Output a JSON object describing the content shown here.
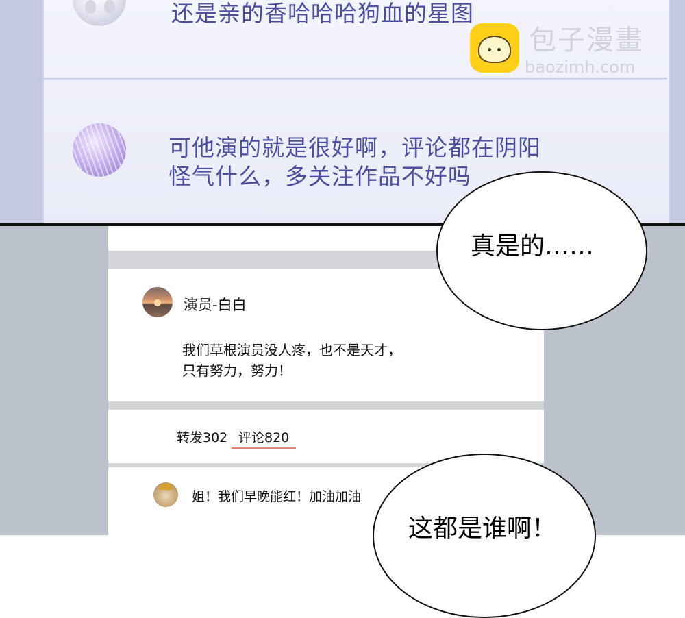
{
  "top_panel": {
    "comment1_text": "还是亲的香哈哈哈狗血的星图",
    "comment2_line1": "可他演的就是很好啊，评论都在阴阳",
    "comment2_line2": "怪气什么，多关注作品不好吗"
  },
  "watermark": {
    "name": "包子漫畫",
    "domain": "baozimh.com"
  },
  "post": {
    "author": "演员-白白",
    "body_line1": "我们草根演员没人疼，也不是天才，",
    "body_line2": "只有努力，努力！"
  },
  "stats": {
    "repost_label": "转发302",
    "comment_label": "评论820"
  },
  "reply": {
    "text": "姐！我们早晚能红！加油加油"
  },
  "bubbles": {
    "bubble1": "真是的……",
    "bubble2": "这都是谁啊！"
  },
  "colors": {
    "top_text": "#4b4fa0",
    "active_tab_underline": "#e8866c",
    "top_background": "#c4c8e2",
    "bottom_background": "#bcc2cc"
  }
}
